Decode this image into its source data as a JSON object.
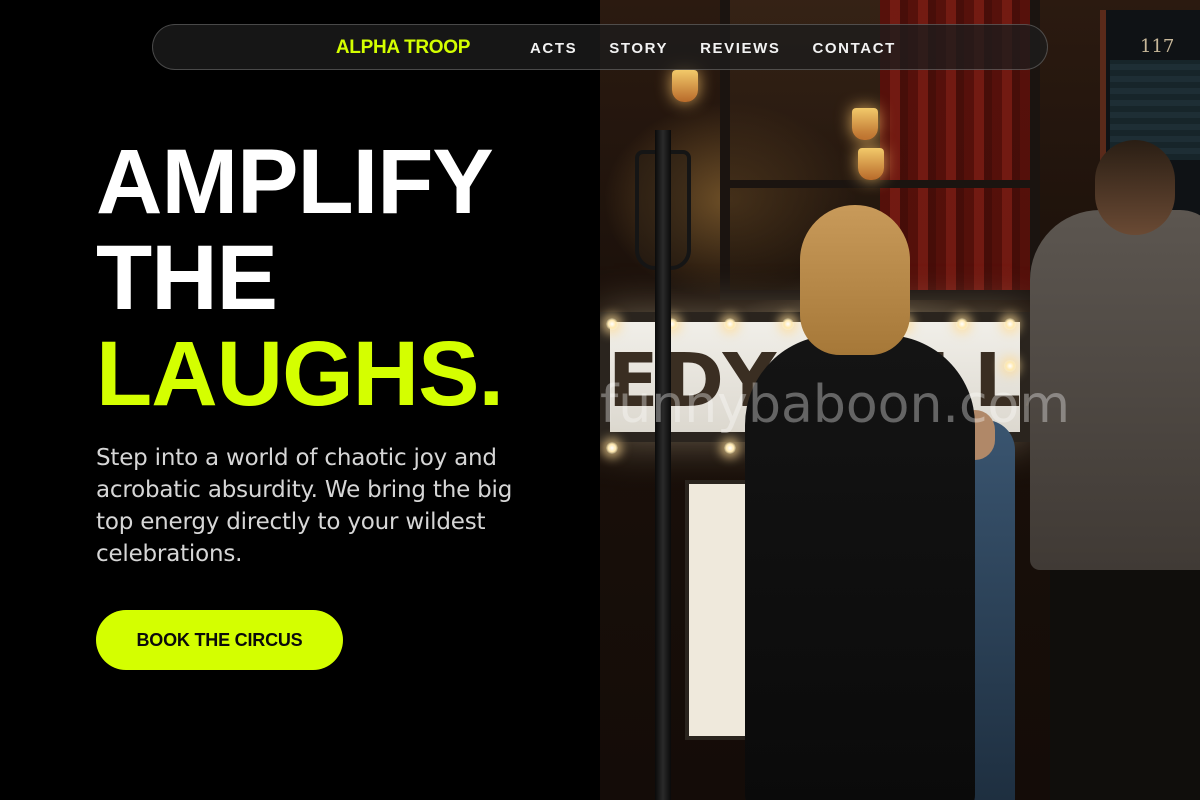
{
  "nav": {
    "brand": "ALPHA TROOP",
    "links": [
      "ACTS",
      "STORY",
      "REVIEWS",
      "CONTACT"
    ]
  },
  "hero": {
    "headline_lines": [
      "AMPLIFY",
      "THE",
      "LAUGHS."
    ],
    "subtext": "Step into a world of chaotic joy and acrobatic absurdity. We bring the big top energy directly to your wildest celebrations.",
    "cta_label": "BOOK THE CIRCUS"
  },
  "photo": {
    "marquee_text": "EDY CELLAR",
    "watermark": "funnybaboon.com",
    "door_number": "117"
  },
  "colors": {
    "background": "#000000",
    "accent": "#d4ff00",
    "text": "#ffffff",
    "subtext": "#d6d6d6",
    "nav_bg": "#1c1c1c"
  }
}
